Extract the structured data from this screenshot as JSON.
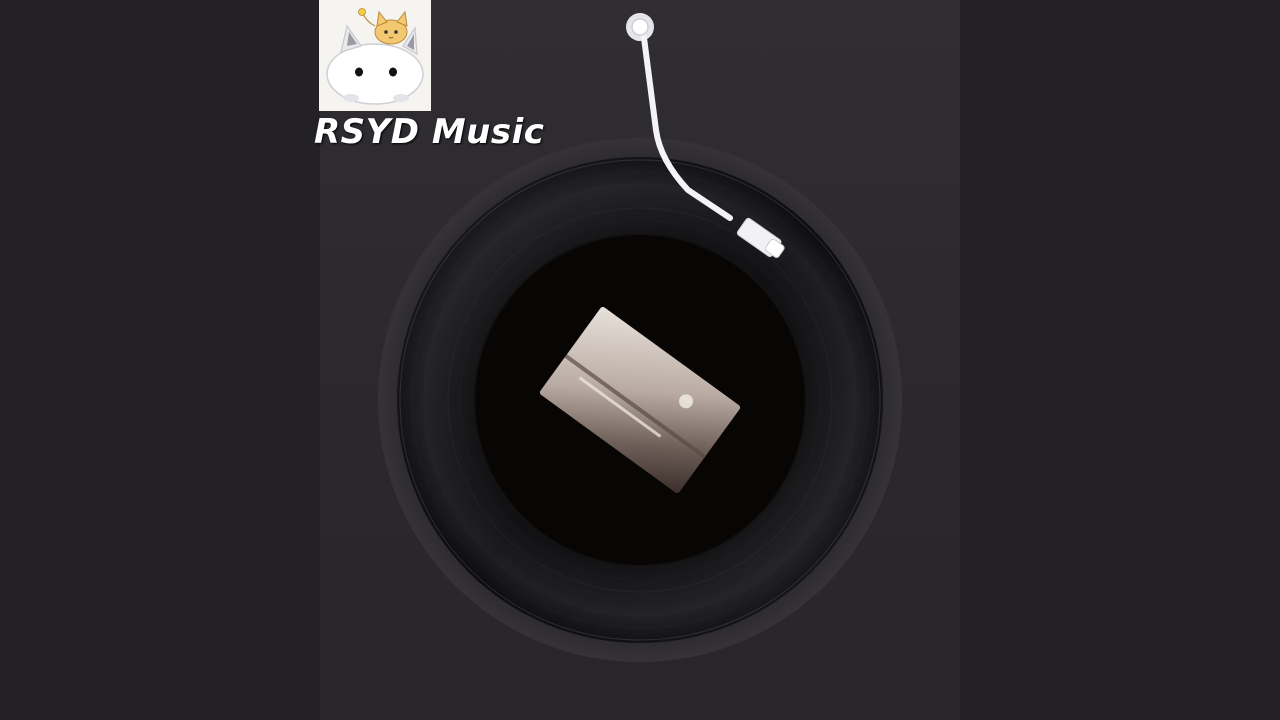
{
  "brand": {
    "name": "RSYD Music"
  },
  "logo": {
    "icon": "cat-mascot-icon"
  },
  "player": {
    "cover_icon": "album-cover-image",
    "record_icon": "vinyl-record-icon",
    "tonearm_icon": "tonearm-icon"
  },
  "colors": {
    "background": "#232125",
    "panel": "#2e2c31",
    "vinyl": "#0d0d0f",
    "tonearm": "#ffffff"
  }
}
